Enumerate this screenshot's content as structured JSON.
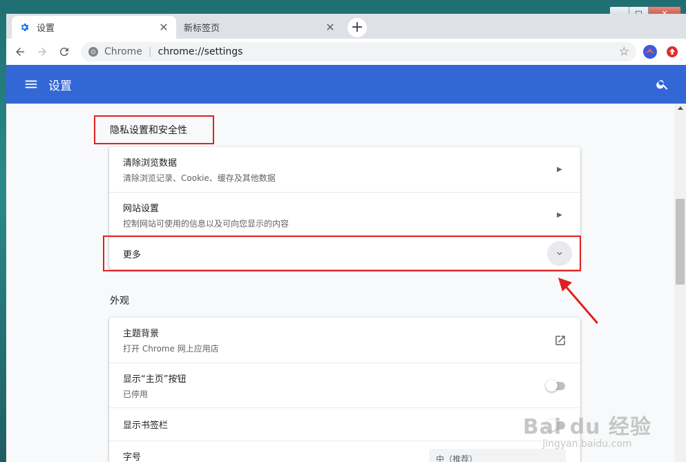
{
  "window": {
    "minimize": "▁",
    "maximize": "□",
    "close": "✕"
  },
  "tabs": [
    {
      "title": "设置",
      "close": "✕"
    },
    {
      "title": "新标签页",
      "close": "✕"
    }
  ],
  "toolbar": {
    "newtab": "+",
    "chip": "Chrome",
    "divider": "|",
    "url": "chrome://settings",
    "star": "☆"
  },
  "header": {
    "title": "设置"
  },
  "privacy": {
    "section_title": "隐私设置和安全性",
    "clear_title": "清除浏览数据",
    "clear_sub": "清除浏览记录、Cookie、缓存及其他数据",
    "site_title": "网站设置",
    "site_sub": "控制网站可使用的信息以及可向您显示的内容",
    "more": "更多"
  },
  "appearance": {
    "section_title": "外观",
    "theme_title": "主题背景",
    "theme_sub": "打开 Chrome 网上应用店",
    "home_title": "显示“主页”按钮",
    "home_sub": "已停用",
    "bookmarks_title": "显示书签栏",
    "font_title": "字号",
    "font_value": "中（推荐）"
  },
  "watermark": {
    "logo": "Bai du 经验",
    "url": "jingyan.baidu.com"
  },
  "colors": {
    "accent": "#3367d6",
    "annotation": "#e02020"
  }
}
